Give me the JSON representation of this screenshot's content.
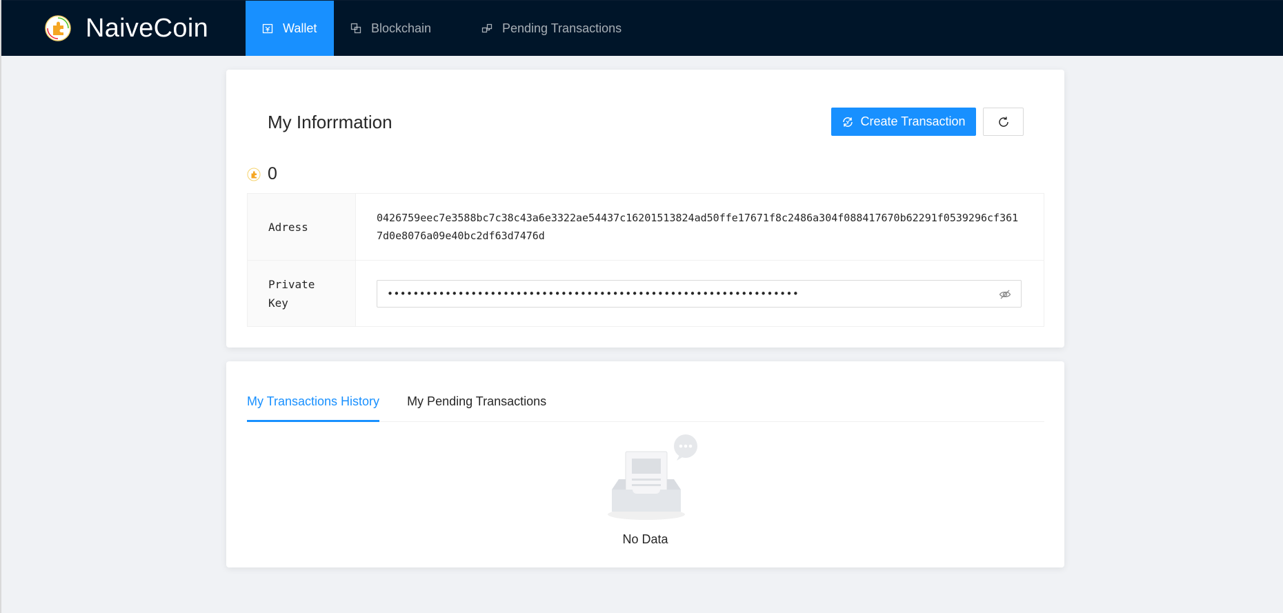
{
  "header": {
    "brand": "NaiveCoin",
    "nav": [
      {
        "label": "Wallet",
        "icon": "wallet-icon",
        "active": true
      },
      {
        "label": "Blockchain",
        "icon": "blockchain-icon"
      },
      {
        "label": "Pending Transactions",
        "icon": "pending-icon"
      }
    ]
  },
  "info": {
    "title": "My Inforrmation",
    "create_transaction_label": "Create Transaction",
    "balance": "0",
    "address_label": "Adress",
    "address_value": "0426759eec7e3588bc7c38c43a6e3322ae54437c16201513824ad50ffe17671f8c2486a304f088417670b62291f0539296cf3617d0e8076a09e40bc2df63d7476d",
    "private_key_label": "Private Key",
    "private_key_masked": "••••••••••••••••••••••••••••••••••••••••••••••••••••••••••••••••"
  },
  "transactions": {
    "tabs": [
      {
        "label": "My Transactions History",
        "active": true
      },
      {
        "label": "My Pending Transactions"
      }
    ],
    "empty_text": "No Data"
  },
  "colors": {
    "header_bg": "#001529",
    "primary": "#1890ff",
    "page_bg": "#f0f2f5"
  }
}
